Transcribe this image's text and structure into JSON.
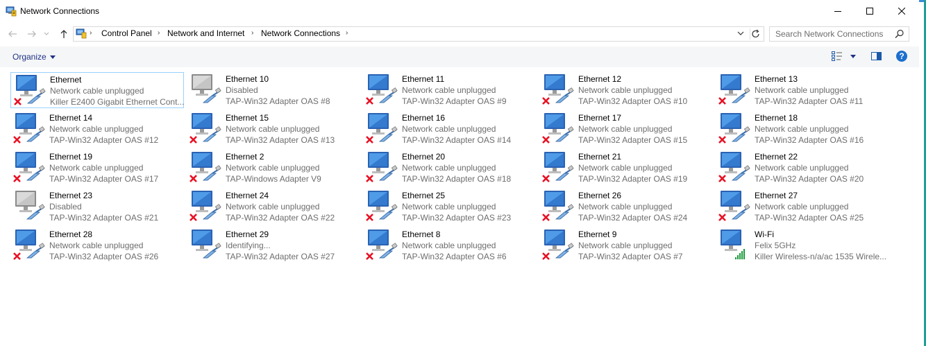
{
  "window": {
    "title": "Network Connections"
  },
  "address": {
    "crumbs": [
      "Control Panel",
      "Network and Internet",
      "Network Connections"
    ]
  },
  "search": {
    "placeholder": "Search Network Connections"
  },
  "toolbar": {
    "organize_label": "Organize"
  },
  "colors": {
    "accent": "#1e3287",
    "selection_border": "#99d1ff",
    "secondary_text": "#6d6d6d",
    "error_red": "#e81123",
    "signal_green": "#1b9b3a"
  },
  "connections": [
    {
      "name": "Ethernet",
      "status": "Network cable unplugged",
      "device": "Killer E2400 Gigabit Ethernet Cont...",
      "icon": "ethernet-unplugged-icon"
    },
    {
      "name": "Ethernet 10",
      "status": "Disabled",
      "device": "TAP-Win32 Adapter OAS #8",
      "icon": "ethernet-disabled-icon"
    },
    {
      "name": "Ethernet 11",
      "status": "Network cable unplugged",
      "device": "TAP-Win32 Adapter OAS #9",
      "icon": "ethernet-unplugged-icon"
    },
    {
      "name": "Ethernet 12",
      "status": "Network cable unplugged",
      "device": "TAP-Win32 Adapter OAS #10",
      "icon": "ethernet-unplugged-icon"
    },
    {
      "name": "Ethernet 13",
      "status": "Network cable unplugged",
      "device": "TAP-Win32 Adapter OAS #11",
      "icon": "ethernet-unplugged-icon"
    },
    {
      "name": "Ethernet 14",
      "status": "Network cable unplugged",
      "device": "TAP-Win32 Adapter OAS #12",
      "icon": "ethernet-unplugged-icon"
    },
    {
      "name": "Ethernet 15",
      "status": "Network cable unplugged",
      "device": "TAP-Win32 Adapter OAS #13",
      "icon": "ethernet-unplugged-icon"
    },
    {
      "name": "Ethernet 16",
      "status": "Network cable unplugged",
      "device": "TAP-Win32 Adapter OAS #14",
      "icon": "ethernet-unplugged-icon"
    },
    {
      "name": "Ethernet 17",
      "status": "Network cable unplugged",
      "device": "TAP-Win32 Adapter OAS #15",
      "icon": "ethernet-unplugged-icon"
    },
    {
      "name": "Ethernet 18",
      "status": "Network cable unplugged",
      "device": "TAP-Win32 Adapter OAS #16",
      "icon": "ethernet-unplugged-icon"
    },
    {
      "name": "Ethernet 19",
      "status": "Network cable unplugged",
      "device": "TAP-Win32 Adapter OAS #17",
      "icon": "ethernet-unplugged-icon"
    },
    {
      "name": "Ethernet 2",
      "status": "Network cable unplugged",
      "device": "TAP-Windows Adapter V9",
      "icon": "ethernet-unplugged-icon"
    },
    {
      "name": "Ethernet 20",
      "status": "Network cable unplugged",
      "device": "TAP-Win32 Adapter OAS #18",
      "icon": "ethernet-unplugged-icon"
    },
    {
      "name": "Ethernet 21",
      "status": "Network cable unplugged",
      "device": "TAP-Win32 Adapter OAS #19",
      "icon": "ethernet-unplugged-icon"
    },
    {
      "name": "Ethernet 22",
      "status": "Network cable unplugged",
      "device": "TAP-Win32 Adapter OAS #20",
      "icon": "ethernet-unplugged-icon"
    },
    {
      "name": "Ethernet 23",
      "status": "Disabled",
      "device": "TAP-Win32 Adapter OAS #21",
      "icon": "ethernet-disabled-icon"
    },
    {
      "name": "Ethernet 24",
      "status": "Network cable unplugged",
      "device": "TAP-Win32 Adapter OAS #22",
      "icon": "ethernet-unplugged-icon"
    },
    {
      "name": "Ethernet 25",
      "status": "Network cable unplugged",
      "device": "TAP-Win32 Adapter OAS #23",
      "icon": "ethernet-unplugged-icon"
    },
    {
      "name": "Ethernet 26",
      "status": "Network cable unplugged",
      "device": "TAP-Win32 Adapter OAS #24",
      "icon": "ethernet-unplugged-icon"
    },
    {
      "name": "Ethernet 27",
      "status": "Network cable unplugged",
      "device": "TAP-Win32 Adapter OAS #25",
      "icon": "ethernet-unplugged-icon"
    },
    {
      "name": "Ethernet 28",
      "status": "Network cable unplugged",
      "device": "TAP-Win32 Adapter OAS #26",
      "icon": "ethernet-unplugged-icon"
    },
    {
      "name": "Ethernet 29",
      "status": "Identifying...",
      "device": "TAP-Win32 Adapter OAS #27",
      "icon": "ethernet-identifying-icon"
    },
    {
      "name": "Ethernet 8",
      "status": "Network cable unplugged",
      "device": "TAP-Win32 Adapter OAS #6",
      "icon": "ethernet-unplugged-icon"
    },
    {
      "name": "Ethernet 9",
      "status": "Network cable unplugged",
      "device": "TAP-Win32 Adapter OAS #7",
      "icon": "ethernet-unplugged-icon"
    },
    {
      "name": "Wi-Fi",
      "status": "Felix 5GHz",
      "device": "Killer Wireless-n/a/ac 1535 Wirele...",
      "icon": "wifi-connected-icon"
    }
  ]
}
